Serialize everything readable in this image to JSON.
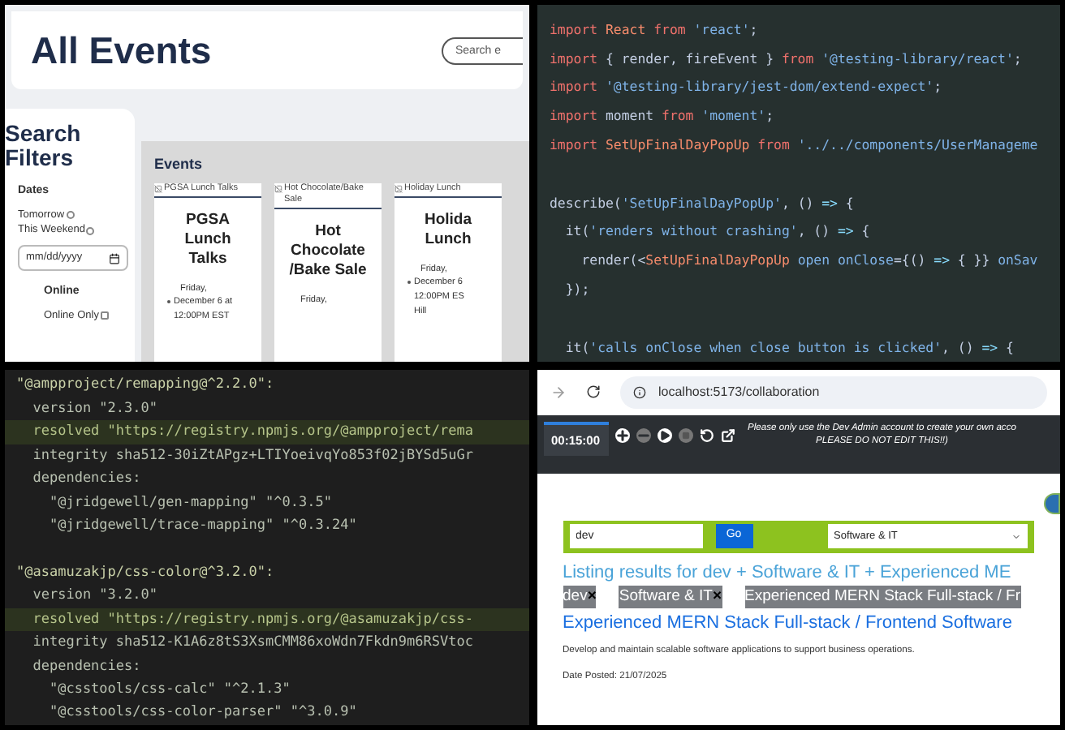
{
  "events_page": {
    "title": "All Events",
    "search": {
      "placeholder": "Search e"
    },
    "filters": {
      "title": "Search Filters",
      "dates_label": "Dates",
      "date_options": [
        {
          "label": "Tomorrow",
          "selected": false
        },
        {
          "label": "This Weekend",
          "selected": false
        }
      ],
      "date_input": {
        "placeholder": "mm/dd/yyyy"
      },
      "online_label": "Online",
      "online_only": {
        "label": "Online Only",
        "checked": false
      }
    },
    "events_heading": "Events",
    "cards": [
      {
        "image_alt": "PGSA Lunch Talks",
        "title": "PGSA Lunch Talks",
        "day": "Friday,",
        "details": [
          "December 6 at 12:00PM EST"
        ]
      },
      {
        "image_alt": "Hot Chocolate/Bake Sale",
        "title": "Hot Chocolate /Bake Sale",
        "day": "Friday,"
      },
      {
        "image_alt": "Holiday Lunch",
        "title": "Holida Lunch",
        "day": "Friday,",
        "details": [
          "December 6 12:00PM ES",
          "Hill"
        ]
      }
    ]
  },
  "test_code": {
    "lines": [
      {
        "kind": "code",
        "tokens": [
          {
            "kind": "keyword",
            "text": "import"
          },
          {
            "kind": "ident",
            "text": " React "
          },
          {
            "kind": "keyword",
            "text": "from"
          },
          {
            "kind": "string",
            "text": " 'react'"
          },
          {
            "kind": "plain",
            "text": ";"
          }
        ]
      },
      {
        "kind": "code",
        "tokens": [
          {
            "kind": "keyword",
            "text": "import"
          },
          {
            "kind": "plain",
            "text": " { render, fireEvent } "
          },
          {
            "kind": "keyword",
            "text": "from"
          },
          {
            "kind": "string",
            "text": " '@testing-library/react'"
          },
          {
            "kind": "plain",
            "text": ";"
          }
        ]
      },
      {
        "kind": "code",
        "tokens": [
          {
            "kind": "keyword",
            "text": "import"
          },
          {
            "kind": "string",
            "text": " '@testing-library/jest-dom/extend-expect'"
          },
          {
            "kind": "plain",
            "text": ";"
          }
        ]
      },
      {
        "kind": "code",
        "tokens": [
          {
            "kind": "keyword",
            "text": "import"
          },
          {
            "kind": "plain",
            "text": " moment "
          },
          {
            "kind": "keyword",
            "text": "from"
          },
          {
            "kind": "string",
            "text": " 'moment'"
          },
          {
            "kind": "plain",
            "text": ";"
          }
        ]
      },
      {
        "kind": "code",
        "tokens": [
          {
            "kind": "keyword",
            "text": "import"
          },
          {
            "kind": "ident",
            "text": " SetUpFinalDayPopUp "
          },
          {
            "kind": "keyword",
            "text": "from"
          },
          {
            "kind": "string",
            "text": " '../../components/UserManageme"
          }
        ]
      },
      {
        "kind": "blank"
      },
      {
        "kind": "code",
        "tokens": [
          {
            "kind": "plain",
            "text": "describe("
          },
          {
            "kind": "string",
            "text": "'SetUpFinalDayPopUp'"
          },
          {
            "kind": "plain",
            "text": ", () "
          },
          {
            "kind": "op",
            "text": "=>"
          },
          {
            "kind": "plain",
            "text": " {"
          }
        ]
      },
      {
        "kind": "code",
        "tokens": [
          {
            "kind": "plain",
            "text": "  it("
          },
          {
            "kind": "string",
            "text": "'renders without crashing'"
          },
          {
            "kind": "plain",
            "text": ", () "
          },
          {
            "kind": "op",
            "text": "=>"
          },
          {
            "kind": "plain",
            "text": " {"
          }
        ]
      },
      {
        "kind": "code",
        "tokens": [
          {
            "kind": "plain",
            "text": "    render(<"
          },
          {
            "kind": "ident",
            "text": "SetUpFinalDayPopUp"
          },
          {
            "kind": "string",
            "text": " open onClose"
          },
          {
            "kind": "plain",
            "text": "={() "
          },
          {
            "kind": "op",
            "text": "=>"
          },
          {
            "kind": "plain",
            "text": " { }} "
          },
          {
            "kind": "string",
            "text": "onSav"
          }
        ]
      },
      {
        "kind": "code",
        "tokens": [
          {
            "kind": "plain",
            "text": "  });"
          }
        ]
      },
      {
        "kind": "blank"
      },
      {
        "kind": "code",
        "tokens": [
          {
            "kind": "plain",
            "text": "  it("
          },
          {
            "kind": "string",
            "text": "'calls onClose when close button is clicked'"
          },
          {
            "kind": "plain",
            "text": ", () "
          },
          {
            "kind": "op",
            "text": "=>"
          },
          {
            "kind": "plain",
            "text": " {"
          }
        ]
      }
    ]
  },
  "lockfile": {
    "lines": [
      {
        "kind": "head",
        "text": "\"@ampproject/remapping@^2.2.0\":"
      },
      {
        "kind": "entry",
        "text": "  version \"2.3.0\""
      },
      {
        "kind": "resolved",
        "text": "  resolved \"https://registry.npmjs.org/@ampproject/rema"
      },
      {
        "kind": "entry",
        "text": "  integrity sha512-30iZtAPgz+LTIYoeivqYo853f02jBYSd5uGr"
      },
      {
        "kind": "entry",
        "text": "  dependencies:"
      },
      {
        "kind": "entry",
        "text": "    \"@jridgewell/gen-mapping\" \"^0.3.5\""
      },
      {
        "kind": "entry",
        "text": "    \"@jridgewell/trace-mapping\" \"^0.3.24\""
      },
      {
        "kind": "blank"
      },
      {
        "kind": "head",
        "text": "\"@asamuzakjp/css-color@^3.2.0\":"
      },
      {
        "kind": "entry",
        "text": "  version \"3.2.0\""
      },
      {
        "kind": "resolved",
        "text": "  resolved \"https://registry.npmjs.org/@asamuzakjp/css-"
      },
      {
        "kind": "entry",
        "text": "  integrity sha512-K1A6z8tS3XsmCMM86xoWdn7Fkdn9m6RSVtoc"
      },
      {
        "kind": "entry",
        "text": "  dependencies:"
      },
      {
        "kind": "entry",
        "text": "    \"@csstools/css-calc\" \"^2.1.3\""
      },
      {
        "kind": "entry",
        "text": "    \"@csstools/css-color-parser\" \"^3.0.9\""
      }
    ]
  },
  "browser": {
    "url": "localhost:5173/collaboration",
    "timer": "00:15:00",
    "notice": [
      "Please only use the Dev Admin account to create your own acco",
      "PLEASE DO NOT EDIT THIS!!)"
    ],
    "search": {
      "value": "dev"
    },
    "go_button": "Go",
    "category": "Software & IT",
    "heading": "Listing results for dev + Software & IT + Experienced ME",
    "tags": [
      {
        "label": "dev",
        "remove": "×"
      },
      {
        "label": "Software & IT",
        "remove": "×"
      },
      {
        "label": "Experienced MERN Stack Full-stack / Fr"
      }
    ],
    "job": {
      "title": "Experienced MERN Stack Full-stack / Frontend Software",
      "description": "Develop and maintain scalable software applications to support business operations.",
      "date": "Date Posted: 21/07/2025"
    }
  }
}
